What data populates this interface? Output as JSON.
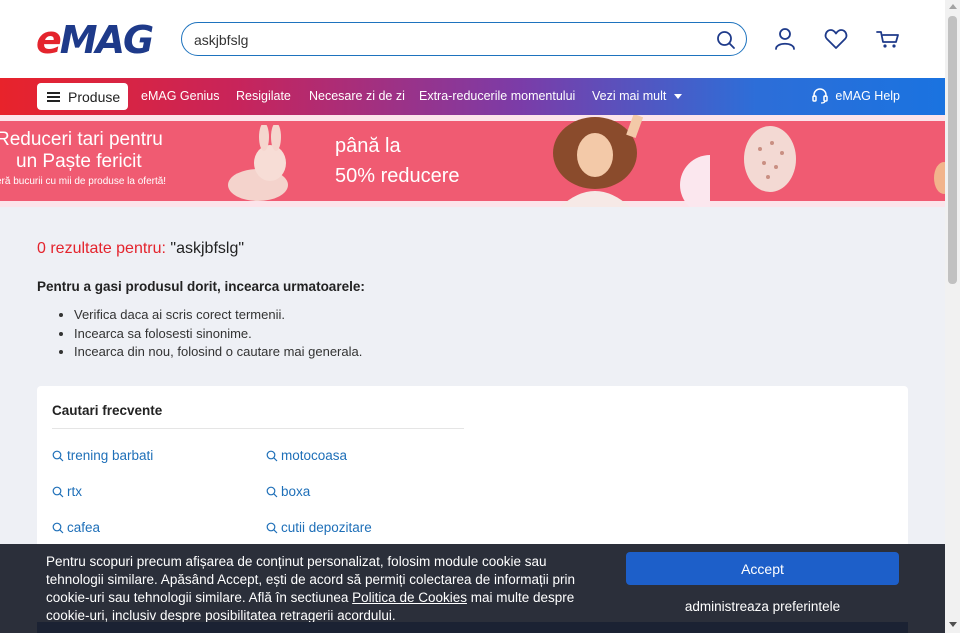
{
  "header": {
    "logo": "eMAG",
    "search": {
      "value": "askjbfslg",
      "placeholder": ""
    }
  },
  "nav": {
    "produse": "Produse",
    "links": [
      "eMAG Genius",
      "Resigilate",
      "Necesare zi de zi",
      "Extra-reducerile momentului",
      "Vezi mai mult"
    ],
    "help": "eMAG Help"
  },
  "banner": {
    "line1": "Reduceri tari pentru",
    "line2": "un Paște fericit",
    "line3": "eră bucurii cu mii de produse la ofertă!",
    "line4": "până la",
    "line5": "50% reducere"
  },
  "results": {
    "count_text": "0 rezultate pentru:",
    "query": "\"askjbfslg\"",
    "hint_title": "Pentru a gasi produsul dorit, incearca urmatoarele:",
    "hints": [
      "Verifica daca ai scris corect termenii.",
      "Incearca sa folosesti sinonime.",
      "Incearca din nou, folosind o cautare mai generala."
    ]
  },
  "frequent": {
    "title": "Cautari frecvente",
    "items": [
      "trening barbati",
      "motocoasa",
      "rtx",
      "boxa",
      "cafea",
      "cutii depozitare"
    ]
  },
  "cookie": {
    "text_before": "Pentru scopuri precum afișarea de conținut personalizat, folosim module cookie sau tehnologii similare. Apăsând Accept, ești de acord să permiți colectarea de informații prin cookie-uri sau tehnologii similare. Află în sectiunea ",
    "link": "Politica de Cookies",
    "text_after": " mai multe despre cookie-uri, inclusiv despre posibilitatea retragerii acordului.",
    "accept": "Accept",
    "preferences": "administreaza preferintele"
  },
  "colors": {
    "brand_red": "#e4242d",
    "brand_blue": "#1e3a8a",
    "link_blue": "#1e6fb8",
    "accept_blue": "#1d5fc9"
  }
}
